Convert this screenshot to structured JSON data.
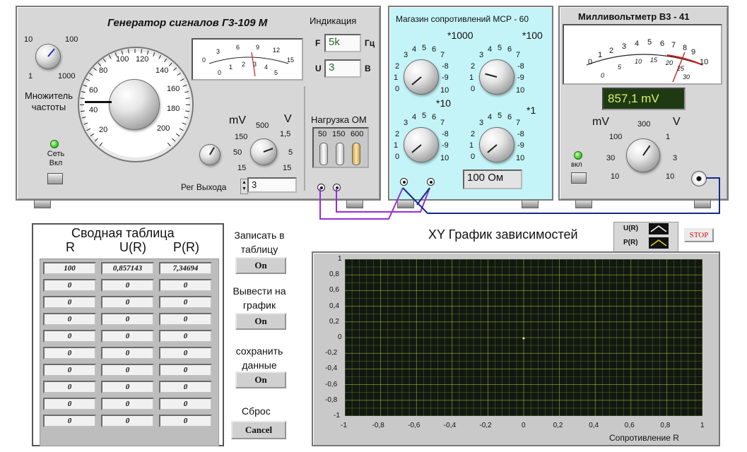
{
  "generator": {
    "title": "Генератор сигналов Г3-109 М",
    "mult_scale": [
      "10",
      "100",
      "1",
      "1000"
    ],
    "mult_label": "Множитель частоты",
    "dial_scale": [
      "100",
      "120",
      "80",
      "140",
      "60",
      "160",
      "40",
      "180",
      "20",
      "200"
    ],
    "meter_top": [
      "0",
      "3",
      "6",
      "9",
      "12",
      "15"
    ],
    "meter_bottom": [
      "0",
      "1",
      "2",
      "3",
      "4",
      "5"
    ],
    "power_label": "Сеть Вкл",
    "indication_label": "Индикация",
    "f_label": "F",
    "f_value": "5k",
    "f_unit": "Гц",
    "u_label": "U",
    "u_value": "3",
    "u_unit": "В",
    "load_label": "Нагрузка ОМ",
    "load_options": [
      "50",
      "150",
      "600"
    ],
    "mv_label": "mV",
    "v_label": "V",
    "level_scale": [
      "500",
      "1,5",
      "150",
      "5",
      "50",
      "15",
      "15"
    ],
    "reg_label": "Рег Выхода",
    "reg_value": "3"
  },
  "resistor_box": {
    "title": "Магазин сопротивлений МСР - 60",
    "multipliers": [
      "*1000",
      "*100",
      "*10",
      "*1"
    ],
    "digits_left": [
      "3",
      "4",
      "5",
      "6",
      "7"
    ],
    "digits_side": [
      "2",
      "-8",
      "1",
      "-9",
      "0",
      "10"
    ],
    "value": "100 Ом"
  },
  "millivoltmeter": {
    "title": "Милливольтметр В3 - 41",
    "scale_top": [
      "0",
      "1",
      "2",
      "3",
      "4",
      "5",
      "6",
      "7",
      "8",
      "9",
      "10"
    ],
    "scale_bottom": [
      "0",
      "5",
      "10",
      "15",
      "20",
      "25",
      "30"
    ],
    "reading": "857,1 mV",
    "mv_label": "mV",
    "v_label": "V",
    "range_scale": [
      "300",
      "100",
      "1",
      "30",
      "3",
      "10",
      "10"
    ],
    "power_label": "вкл"
  },
  "summary": {
    "title": "Сводная таблица",
    "headers": [
      "R",
      "U(R)",
      "P(R)"
    ],
    "rows": [
      [
        "100",
        "0,857143",
        "7,34694"
      ],
      [
        "0",
        "0",
        "0"
      ],
      [
        "0",
        "0",
        "0"
      ],
      [
        "0",
        "0",
        "0"
      ],
      [
        "0",
        "0",
        "0"
      ],
      [
        "0",
        "0",
        "0"
      ],
      [
        "0",
        "0",
        "0"
      ],
      [
        "0",
        "0",
        "0"
      ],
      [
        "0",
        "0",
        "0"
      ],
      [
        "0",
        "0",
        "0"
      ]
    ],
    "write_label": "Записать в таблицу",
    "write_btn": "On",
    "plot_label": "Вывести на график",
    "plot_btn": "On",
    "save_label": "сохранить данные",
    "save_btn": "On",
    "reset_label": "Сброс",
    "reset_btn": "Cancel"
  },
  "graph": {
    "title": "XY График зависимостей",
    "legend": [
      "U(R)",
      "P(R)"
    ],
    "stop_label": "STOP",
    "xlabel": "Сопротивление R",
    "xticks": [
      "-1",
      "-0,8",
      "-0,6",
      "-0,4",
      "-0,2",
      "0",
      "0,2",
      "0,4",
      "0,6",
      "0,8",
      "1"
    ],
    "yticks": [
      "1",
      "0,8",
      "0,6",
      "0,4",
      "0,2",
      "0",
      "-0,2",
      "-0,4",
      "-0,6",
      "-0,8",
      "-1"
    ],
    "plot_bg": "#111811",
    "grid_color": "#c8e040"
  }
}
